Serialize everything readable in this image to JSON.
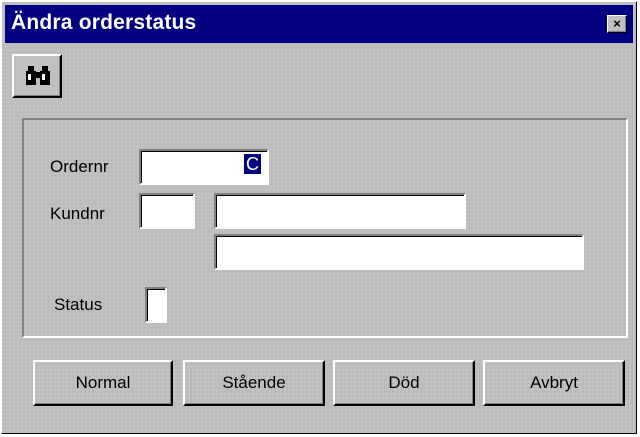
{
  "window": {
    "title": "Ändra orderstatus",
    "close_glyph": "×"
  },
  "toolbar": {
    "search_icon": "binoculars-icon"
  },
  "form": {
    "ordernr_label": "Ordernr",
    "ordernr_value": "C",
    "kundnr_label": "Kundnr",
    "kundnr_value": "",
    "customer_name_value": "",
    "customer_address_value": "",
    "status_label": "Status",
    "status_value": ""
  },
  "buttons": {
    "normal": "Normal",
    "staende": "Stående",
    "dod": "Död",
    "avbryt": "Avbryt"
  },
  "colors": {
    "titlebar": "#000080",
    "face": "#c0c0c0"
  }
}
